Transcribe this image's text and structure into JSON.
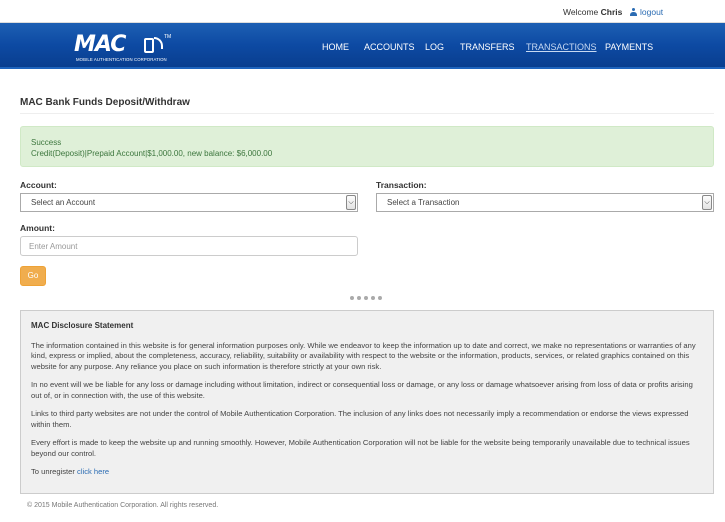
{
  "topbar": {
    "welcome_prefix": "Welcome",
    "user_name": "Chris",
    "logout_label": "logout"
  },
  "brand": {
    "logo_text": "MAC",
    "tagline": "MOBILE AUTHENTICATION CORPORATION",
    "tm": "TM"
  },
  "nav": {
    "items": [
      {
        "label": "HOME"
      },
      {
        "label": "ACCOUNTS"
      },
      {
        "label": "LOG"
      },
      {
        "label": "TRANSFERS"
      },
      {
        "label": "TRANSACTIONS"
      },
      {
        "label": "PAYMENTS"
      }
    ],
    "active": "TRANSACTIONS"
  },
  "page": {
    "title": "MAC Bank Funds Deposit/Withdraw"
  },
  "alert": {
    "heading": "Success",
    "message": "Credit(Deposit)|Prepaid Account|$1,000.00, new balance: $6,000.00"
  },
  "form": {
    "account_label": "Account:",
    "account_selected": "Select an Account",
    "transaction_label": "Transaction:",
    "transaction_selected": "Select a Transaction",
    "amount_label": "Amount:",
    "amount_placeholder": "Enter Amount",
    "amount_value": "",
    "go_label": "Go"
  },
  "disclosure": {
    "title": "MAC Disclosure Statement",
    "paragraphs": [
      "The information contained in this website is for general information purposes only. While we endeavor to keep the information up to date and correct, we make no representations or warranties of any kind, express or implied, about the completeness, accuracy, reliability, suitability or availability with respect to the website or the information, products, services, or related graphics contained on this website for any purpose. Any reliance you place on such information is therefore strictly at your own risk.",
      "In no event will we be liable for any loss or damage including without limitation, indirect or consequential loss or damage, or any loss or damage whatsoever arising from loss of data or profits arising out of, or in connection with, the use of this website.",
      "Links to third party websites are not under the control of Mobile Authentication Corporation. The inclusion of any links does not necessarily imply a recommendation or endorse the views expressed within them.",
      "Every effort is made to keep the website up and running smoothly. However, Mobile Authentication Corporation will not be liable for the website being temporarily unavailable due to technical issues beyond our control."
    ],
    "unregister_prefix": "To unregister",
    "unregister_link": "click here"
  },
  "footer": {
    "copyright": "© 2015 Mobile Authentication Corporation. All rights reserved."
  }
}
